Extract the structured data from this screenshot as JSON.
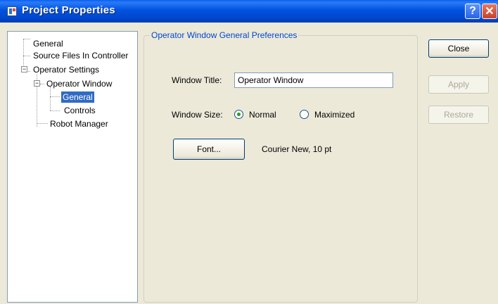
{
  "window": {
    "title": "Project Properties",
    "help_glyph": "?",
    "close_glyph": "✕"
  },
  "tree": {
    "items": [
      {
        "label": "General"
      },
      {
        "label": "Source Files In Controller"
      },
      {
        "label": "Operator Settings",
        "expander": "−"
      },
      {
        "label": "Operator Window",
        "expander": "−"
      },
      {
        "label": "General",
        "selected": true
      },
      {
        "label": "Controls"
      },
      {
        "label": "Robot Manager"
      }
    ]
  },
  "panel": {
    "group_title": "Operator Window General Preferences",
    "window_title_label": "Window Title:",
    "window_title_value": "Operator Window",
    "window_size_label": "Window Size:",
    "size_options": [
      {
        "label": "Normal",
        "checked": true
      },
      {
        "label": "Maximized",
        "checked": false
      }
    ],
    "font_button": "Font...",
    "font_value": "Courier New, 10 pt"
  },
  "buttons": {
    "close": "Close",
    "apply": "Apply",
    "restore": "Restore"
  },
  "colors": {
    "titlebar": "#0052e0",
    "selection": "#316ac5",
    "group_title": "#0046d5",
    "dialog_bg": "#ece9d8"
  }
}
